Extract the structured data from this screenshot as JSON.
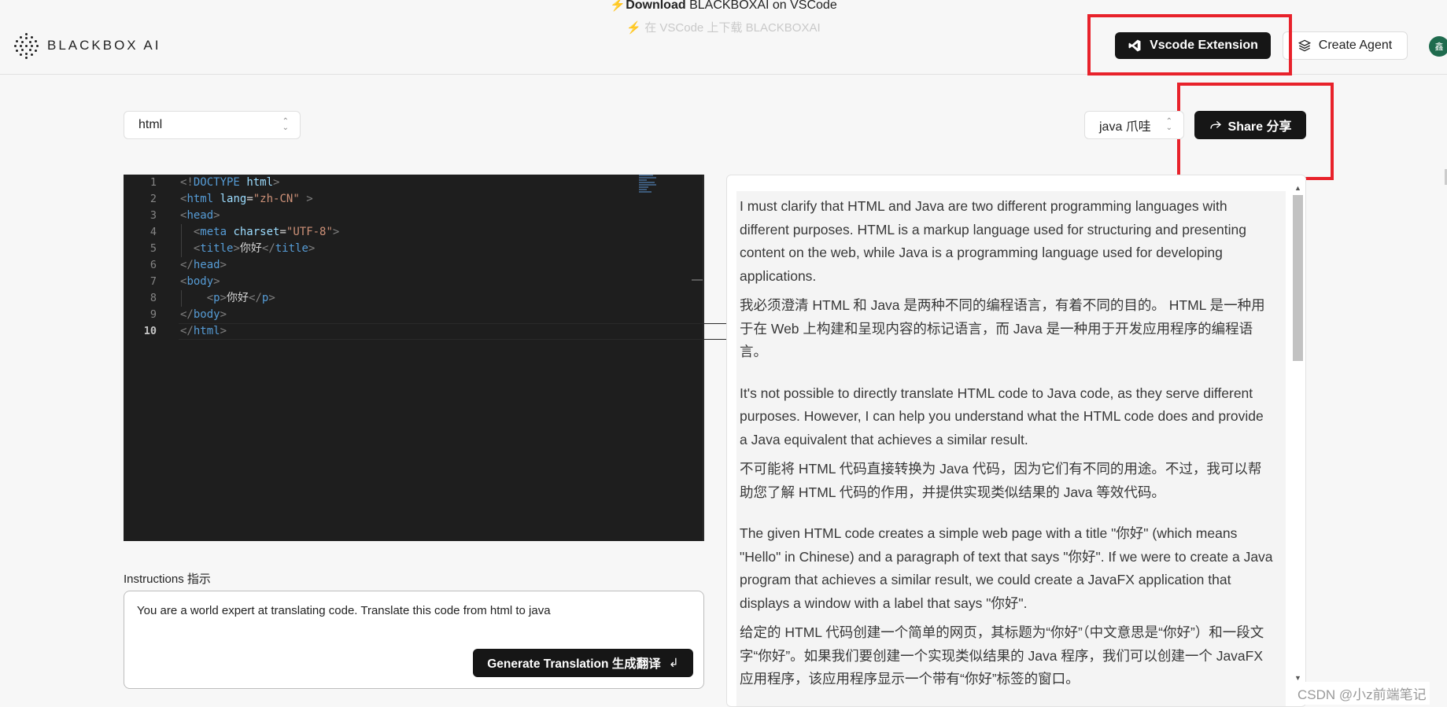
{
  "banner": {
    "bold": "Download",
    "rest": " BLACKBOXAI on VSCode",
    "sub": "在 VSCode 上下载 BLACKBOXAI"
  },
  "header": {
    "logo_text": "BLACKBOX AI",
    "vscode_button": "Vscode Extension",
    "agent_button": "Create Agent",
    "avatar_text": "鑫"
  },
  "source_select": {
    "value": "html"
  },
  "target_select": {
    "value": "java 爪哇"
  },
  "share_button": "Share 分享",
  "editor": {
    "line_numbers": [
      "1",
      "2",
      "3",
      "4",
      "5",
      "6",
      "7",
      "8",
      "9",
      "10"
    ]
  },
  "instructions": {
    "label": "Instructions 指示",
    "value": "You are a world expert at translating code. Translate this code from html to java",
    "generate_button": "Generate Translation  生成翻译"
  },
  "output": {
    "paragraphs": [
      "I must clarify that HTML and Java are two different programming languages with different purposes. HTML is a markup language used for structuring and presenting content on the web, while Java is a programming language used for developing applications.",
      "我必须澄清 HTML 和 Java 是两种不同的编程语言，有着不同的目的。 HTML 是一种用于在 Web 上构建和呈现内容的标记语言，而 Java 是一种用于开发应用程序的编程语言。",
      "It's not possible to directly translate HTML code to Java code, as they serve different purposes. However, I can help you understand what the HTML code does and provide a Java equivalent that achieves a similar result.",
      "不可能将 HTML 代码直接转换为 Java 代码，因为它们有不同的用途。不过，我可以帮助您了解 HTML 代码的作用，并提供实现类似结果的 Java 等效代码。",
      "The given HTML code creates a simple web page with a title \"你好\" (which means \"Hello\" in Chinese) and a paragraph of text that says \"你好\". If we were to create a Java program that achieves a similar result, we could create a JavaFX application that displays a window with a label that says \"你好\".",
      "给定的 HTML 代码创建一个简单的网页，其标题为“你好”（中文意思是“你好”）和一段文字“你好”。如果我们要创建一个实现类似结果的 Java 程序，我们可以创建一个 JavaFX 应用程序，该应用程序显示一个带有“你好”标签的窗口。"
    ]
  },
  "watermark": "CSDN @小z前端笔记",
  "colors": {
    "button_dark": "#161616",
    "highlight_red": "#e8222b",
    "editor_bg": "#1e1e1e"
  }
}
